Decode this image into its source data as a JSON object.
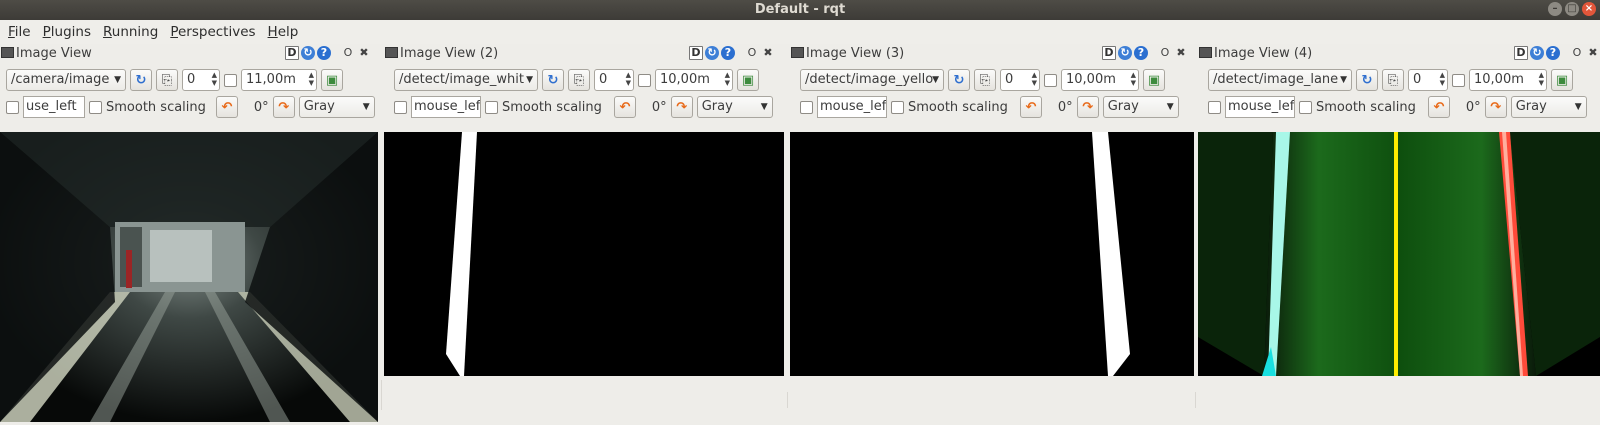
{
  "window": {
    "title": "Default - rqt",
    "buttons": [
      "minimize",
      "maximize",
      "close"
    ]
  },
  "menubar": {
    "items": [
      "File",
      "Plugins",
      "Running",
      "Perspectives",
      "Help"
    ]
  },
  "panels": [
    {
      "title": "Image View",
      "topic": "/camera/image",
      "spin1": "0",
      "spin2": "11,00m",
      "mouse_field": "use_left",
      "smooth_label": "Smooth scaling",
      "rotation": "0°",
      "color_mode": "Gray"
    },
    {
      "title": "Image View (2)",
      "topic": "/detect/image_whit",
      "spin1": "0",
      "spin2": "10,00m",
      "mouse_field": "mouse_left",
      "smooth_label": "Smooth scaling",
      "rotation": "0°",
      "color_mode": "Gray"
    },
    {
      "title": "Image View (3)",
      "topic": "/detect/image_yello",
      "spin1": "0",
      "spin2": "10,00m",
      "mouse_field": "mouse_left",
      "smooth_label": "Smooth scaling",
      "rotation": "0°",
      "color_mode": "Gray"
    },
    {
      "title": "Image View (4)",
      "topic": "/detect/image_lane",
      "spin1": "0",
      "spin2": "10,00m",
      "mouse_field": "mouse_left",
      "smooth_label": "Smooth scaling",
      "rotation": "0°",
      "color_mode": "Gray"
    }
  ],
  "title_buttons": {
    "d": "D",
    "o": "O",
    "x": "✖"
  },
  "colors": {
    "titlebar": "#3d3b37",
    "background": "#eeede9",
    "close": "#e2563a",
    "accent_blue": "#3e7fd6",
    "accent_orange": "#e86a1a"
  }
}
